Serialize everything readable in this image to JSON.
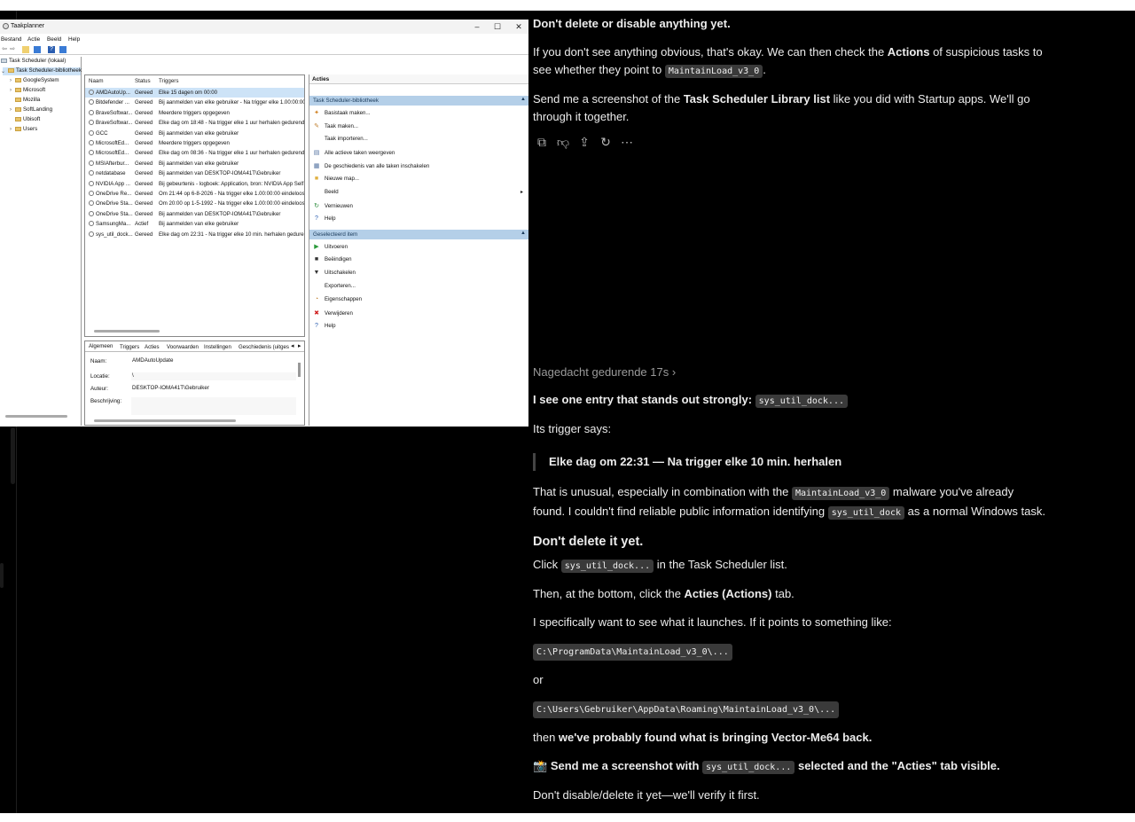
{
  "window": {
    "title": "Taakplanner",
    "controls": [
      "–",
      "☐",
      "✕"
    ],
    "menu": [
      "Bestand",
      "Actie",
      "Beeld",
      "Help"
    ]
  },
  "tree": {
    "root": "Task Scheduler (lokaal)",
    "library": "Task Scheduler-bibliotheek",
    "folders": [
      "GoogleSystem",
      "Microsoft",
      "Mozilla",
      "SoftLanding",
      "Ubisoft",
      "Users"
    ]
  },
  "task_list": {
    "columns": [
      "Naam",
      "Status",
      "Triggers"
    ],
    "rows": [
      {
        "name": "AMDAutoUp...",
        "status": "Gereed",
        "trigger": "Elke 15 dagen om 00:00"
      },
      {
        "name": "Bitdefender ...",
        "status": "Gereed",
        "trigger": "Bij aanmelden van elke gebruiker - Na trigger elke 1.00:00:00"
      },
      {
        "name": "BraveSoftwar...",
        "status": "Gereed",
        "trigger": "Meerdere triggers opgegeven"
      },
      {
        "name": "BraveSoftwar...",
        "status": "Gereed",
        "trigger": "Elke dag om 18:48 - Na trigger elke 1 uur herhalen gedurend"
      },
      {
        "name": "GCC",
        "status": "Gereed",
        "trigger": "Bij aanmelden van elke gebruiker"
      },
      {
        "name": "MicrosoftEd...",
        "status": "Gereed",
        "trigger": "Meerdere triggers opgegeven"
      },
      {
        "name": "MicrosoftEd...",
        "status": "Gereed",
        "trigger": "Elke dag om 08:36 - Na trigger elke 1 uur herhalen gedurend"
      },
      {
        "name": "MSIAfterbur...",
        "status": "Gereed",
        "trigger": "Bij aanmelden van elke gebruiker"
      },
      {
        "name": "netdatabase",
        "status": "Gereed",
        "trigger": "Bij aanmelden van DESKTOP-IOMA41T\\Gebruiker"
      },
      {
        "name": "NVIDIA App ...",
        "status": "Gereed",
        "trigger": "Bij gebeurtenis - logboek: Application, bron: NVIDIA App Self"
      },
      {
        "name": "OneDrive Re...",
        "status": "Gereed",
        "trigger": "Om 21:44 op 6-8-2026 - Na trigger elke 1.00:00:00 eindeloos h"
      },
      {
        "name": "OneDrive Sta...",
        "status": "Gereed",
        "trigger": "Om 20:00 op 1-5-1992 - Na trigger elke 1.00:00:00 eindeloos h"
      },
      {
        "name": "OneDrive Sta...",
        "status": "Gereed",
        "trigger": "Bij aanmelden van DESKTOP-IOMA41T\\Gebruiker"
      },
      {
        "name": "SamsungMa...",
        "status": "Actief",
        "trigger": "Bij aanmelden van elke gebruiker"
      },
      {
        "name": "sys_util_dock...",
        "status": "Gereed",
        "trigger": "Elke dag om 22:31 - Na trigger elke 10 min. herhalen gedurer"
      }
    ]
  },
  "detail": {
    "tabs": [
      "Algemeen",
      "Triggers",
      "Acties",
      "Voorwaarden",
      "Instellingen",
      "Geschiedenis (uitges"
    ],
    "fields": [
      {
        "label": "Naam:",
        "value": "AMDAutoUpdate"
      },
      {
        "label": "Locatie:",
        "value": "\\"
      },
      {
        "label": "Auteur:",
        "value": "DESKTOP-IOMA41T\\Gebruiker"
      },
      {
        "label": "Beschrijving:",
        "value": ""
      }
    ]
  },
  "actions_pane": {
    "header": "Acties",
    "section1": "Task Scheduler-bibliotheek",
    "items1": [
      {
        "label": "Basistaak maken...",
        "icon": "wizard-icon"
      },
      {
        "label": "Taak maken...",
        "icon": "task-icon"
      },
      {
        "label": "Taak importeren...",
        "icon": ""
      },
      {
        "label": "Alle actieve taken weergeven",
        "icon": "list-icon"
      },
      {
        "label": "De geschiedenis van alle taken inschakelen",
        "icon": "history-icon"
      },
      {
        "label": "Nieuwe map...",
        "icon": "folder-icon"
      },
      {
        "label": "Beeld",
        "icon": ""
      },
      {
        "label": "Vernieuwen",
        "icon": "refresh-icon"
      },
      {
        "label": "Help",
        "icon": "help-icon"
      }
    ],
    "section2": "Geselecteerd item",
    "items2": [
      {
        "label": "Uitvoeren",
        "icon": "run-icon"
      },
      {
        "label": "Beëindigen",
        "icon": "stop-icon"
      },
      {
        "label": "Uitschakelen",
        "icon": "disable-icon"
      },
      {
        "label": "Exporteren...",
        "icon": ""
      },
      {
        "label": "Eigenschappen",
        "icon": "properties-icon"
      },
      {
        "label": "Verwijderen",
        "icon": "delete-icon"
      },
      {
        "label": "Help",
        "icon": "help-icon"
      }
    ]
  },
  "chat": {
    "p1": "Don't delete or disable anything yet.",
    "p2a": "If you don't see anything obvious, that's okay. We can then check the ",
    "p2b": "Actions",
    "p2c": " of suspicious tasks to see whether they point to ",
    "p2code": "MaintainLoad_v3_0",
    "p2d": ".",
    "p3a": "Send me a screenshot of the ",
    "p3b": "Task Scheduler Library list",
    "p3c": " like you did with Startup apps. We'll go through it together.",
    "thought": "Nagedacht gedurende 17s",
    "p4a": "I see one entry that stands out strongly: ",
    "p4code": "sys_util_dock...",
    "p5": "Its trigger says:",
    "quote": "Elke dag om 22:31 — Na trigger elke 10 min. herhalen",
    "p6a": "That is unusual, especially in combination with the ",
    "p6code1": "MaintainLoad_v3_0",
    "p6b": " malware you've already found. I couldn't find reliable public information identifying ",
    "p6code2": "sys_util_dock",
    "p6c": " as a normal Windows task.",
    "h1": "Don't delete it yet.",
    "p7a": "Click ",
    "p7code": "sys_util_dock...",
    "p7b": " in the Task Scheduler list.",
    "p8a": "Then, at the bottom, click the ",
    "p8b": "Acties (Actions)",
    "p8c": " tab.",
    "p9": "I specifically want to see what it launches. If it points to something like:",
    "code1": "C:\\ProgramData\\MaintainLoad_v3_0\\...",
    "p10": "or",
    "code2": "C:\\Users\\Gebruiker\\AppData\\Roaming\\MaintainLoad_v3_0\\...",
    "p11a": "then ",
    "p11b": "we've probably found what is bringing Vector-Me64 back.",
    "p12icon": "📸",
    "p12a": "Send me a screenshot with ",
    "p12code": "sys_util_dock...",
    "p12b": " selected and the \"Acties\" tab visible.",
    "p13": "Don't disable/delete it yet—we'll verify it first."
  }
}
